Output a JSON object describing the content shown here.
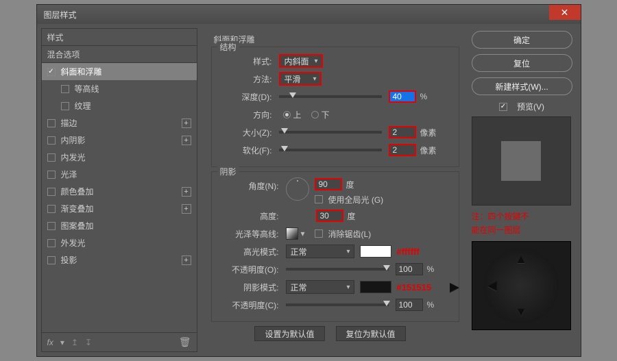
{
  "title": "图层样式",
  "sidebar": {
    "header": "样式",
    "blend": "混合选项",
    "items": [
      {
        "label": "斜面和浮雕",
        "checked": true,
        "selected": true,
        "plus": false
      },
      {
        "label": "等高线",
        "checked": false,
        "sub": true
      },
      {
        "label": "纹理",
        "checked": false,
        "sub": true
      },
      {
        "label": "描边",
        "checked": false,
        "plus": true
      },
      {
        "label": "内阴影",
        "checked": false,
        "plus": true
      },
      {
        "label": "内发光",
        "checked": false
      },
      {
        "label": "光泽",
        "checked": false
      },
      {
        "label": "颜色叠加",
        "checked": false,
        "plus": true
      },
      {
        "label": "渐变叠加",
        "checked": false,
        "plus": true
      },
      {
        "label": "图案叠加",
        "checked": false
      },
      {
        "label": "外发光",
        "checked": false
      },
      {
        "label": "投影",
        "checked": false,
        "plus": true
      }
    ],
    "fx": "fx"
  },
  "main": {
    "section_title": "斜面和浮雕",
    "structure": {
      "legend": "结构",
      "style_label": "样式:",
      "style_value": "内斜面",
      "method_label": "方法:",
      "method_value": "平滑",
      "depth_label": "深度(D):",
      "depth_value": "40",
      "depth_unit": "%",
      "direction_label": "方向:",
      "up": "上",
      "down": "下",
      "size_label": "大小(Z):",
      "size_value": "2",
      "size_unit": "像素",
      "soften_label": "软化(F):",
      "soften_value": "2",
      "soften_unit": "像素"
    },
    "shading": {
      "legend": "阴影",
      "angle_label": "角度(N):",
      "angle_value": "90",
      "angle_unit": "度",
      "global_light": "使用全局光 (G)",
      "altitude_label": "高度:",
      "altitude_value": "30",
      "altitude_unit": "度",
      "gloss_label": "光泽等高线:",
      "antialias": "消除锯齿(L)",
      "highlight_mode_label": "高光模式:",
      "highlight_mode_value": "正常",
      "highlight_color": "#ffffff",
      "highlight_annot": "#ffffff",
      "highlight_opacity_label": "不透明度(O):",
      "highlight_opacity_value": "100",
      "pct": "%",
      "shadow_mode_label": "阴影模式:",
      "shadow_mode_value": "正常",
      "shadow_color": "#151515",
      "shadow_annot": "#151515",
      "shadow_opacity_label": "不透明度(C):",
      "shadow_opacity_value": "100"
    },
    "set_default": "设置为默认值",
    "reset_default": "复位为默认值"
  },
  "right": {
    "ok": "确定",
    "reset": "复位",
    "new_style": "新建样式(W)...",
    "preview": "预览(V)",
    "note1": "注：四个按键不",
    "note2": "能在同一图层"
  }
}
